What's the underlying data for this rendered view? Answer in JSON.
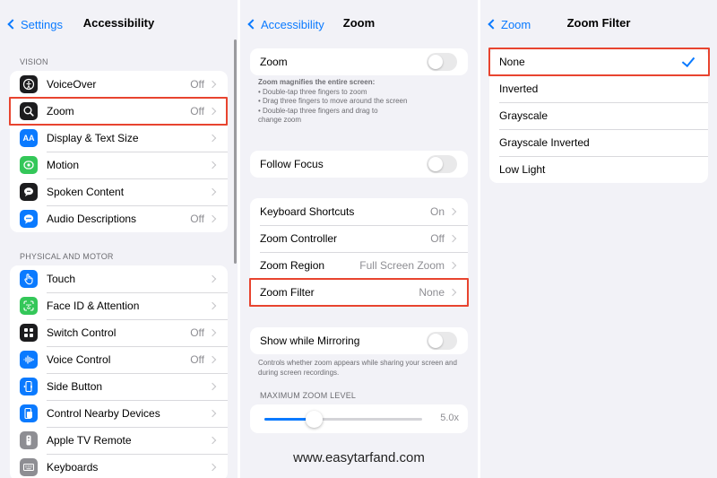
{
  "panel1": {
    "back_label": "Settings",
    "title": "Accessibility",
    "vision_header": "VISION",
    "vision_items": [
      {
        "label": "VoiceOver",
        "value": "Off",
        "icon": "voiceover-icon",
        "color": "#1c1c1e"
      },
      {
        "label": "Zoom",
        "value": "Off",
        "icon": "zoom-icon",
        "color": "#1c1c1e"
      },
      {
        "label": "Display & Text Size",
        "value": "",
        "icon": "text-size-icon",
        "color": "#0a7aff"
      },
      {
        "label": "Motion",
        "value": "",
        "icon": "motion-icon",
        "color": "#34c759"
      },
      {
        "label": "Spoken Content",
        "value": "",
        "icon": "speech-bubble-icon",
        "color": "#1c1c1e"
      },
      {
        "label": "Audio Descriptions",
        "value": "Off",
        "icon": "audio-description-icon",
        "color": "#0a7aff"
      }
    ],
    "motor_header": "PHYSICAL AND MOTOR",
    "motor_items": [
      {
        "label": "Touch",
        "value": "",
        "icon": "hand-icon",
        "color": "#0a7aff"
      },
      {
        "label": "Face ID & Attention",
        "value": "",
        "icon": "face-id-icon",
        "color": "#34c759"
      },
      {
        "label": "Switch Control",
        "value": "Off",
        "icon": "switch-grid-icon",
        "color": "#1c1c1e"
      },
      {
        "label": "Voice Control",
        "value": "Off",
        "icon": "waveform-icon",
        "color": "#0a7aff"
      },
      {
        "label": "Side Button",
        "value": "",
        "icon": "side-button-icon",
        "color": "#0a7aff"
      },
      {
        "label": "Control Nearby Devices",
        "value": "",
        "icon": "nearby-devices-icon",
        "color": "#0a7aff"
      },
      {
        "label": "Apple TV Remote",
        "value": "",
        "icon": "remote-icon",
        "color": "#8e8e93"
      },
      {
        "label": "Keyboards",
        "value": "",
        "icon": "keyboard-icon",
        "color": "#8e8e93"
      }
    ]
  },
  "panel2": {
    "back_label": "Accessibility",
    "title": "Zoom",
    "zoom_label": "Zoom",
    "zoom_note_title": "Zoom magnifies the entire screen:",
    "zoom_note_lines": [
      "Double-tap three fingers to zoom",
      "Drag three fingers to move around the screen",
      "Double-tap three fingers and drag to"
    ],
    "zoom_note_tail": "change zoom",
    "follow_focus_label": "Follow Focus",
    "settings_items": [
      {
        "label": "Keyboard Shortcuts",
        "value": "On"
      },
      {
        "label": "Zoom Controller",
        "value": "Off"
      },
      {
        "label": "Zoom Region",
        "value": "Full Screen Zoom"
      },
      {
        "label": "Zoom Filter",
        "value": "None"
      }
    ],
    "mirroring_label": "Show while Mirroring",
    "mirroring_note": "Controls whether zoom appears while sharing your screen and during screen recordings.",
    "max_zoom_header": "MAXIMUM ZOOM LEVEL",
    "max_zoom_value": "5.0x",
    "max_zoom_fraction": 0.31
  },
  "panel3": {
    "back_label": "Zoom",
    "title": "Zoom Filter",
    "options": [
      "None",
      "Inverted",
      "Grayscale",
      "Grayscale Inverted",
      "Low Light"
    ],
    "selected": "None"
  },
  "watermark": "www.easytarfand.com",
  "colors": {
    "accent": "#0a7aff",
    "highlight": "#e8442f",
    "background": "#f2f2f7"
  }
}
